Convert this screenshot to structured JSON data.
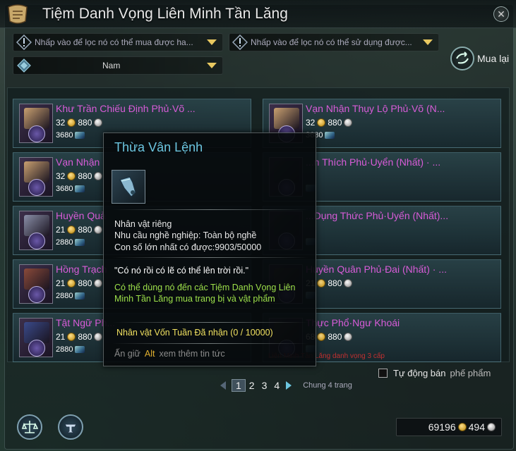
{
  "window": {
    "title": "Tiệm Danh Vọng Liên Minh Tần Lăng",
    "close_label": "✕"
  },
  "filters": {
    "buyable_placeholder": "Nhấp vào để lọc nó có thể mua được ha...",
    "usable_placeholder": "Nhấp vào để lọc nó có thể sử dụng được...",
    "gender_value": "Nam"
  },
  "buyback": {
    "label": "Mua lại"
  },
  "items": [
    {
      "name": "Khư Trần Chiếu Định Phủ·Võ ...",
      "price_gold": "32",
      "price_silver": "880",
      "price_alt": "3680",
      "color": "#c9a070"
    },
    {
      "name": "Vạn Nhận Thụy Lộ Phủ·Võ (N...",
      "price_gold": "32",
      "price_silver": "880",
      "price_alt": "3680",
      "color": "#c9a070"
    },
    {
      "name": "Vạn Nhận",
      "price_gold": "32",
      "price_silver": "880",
      "price_alt": "3680",
      "color": "#c9a070"
    },
    {
      "name": "...n Thích Phủ·Uyển (Nhất) · ...",
      "price_gold": "",
      "price_silver": "",
      "price_alt": "",
      "color": "#2e3a3a"
    },
    {
      "name": "Huyền Quả",
      "price_gold": "21",
      "price_silver": "880",
      "price_alt": "2880",
      "color": "#8a8fa8"
    },
    {
      "name": "...Dụng Thức Phủ·Uyển (Nhất)...",
      "price_gold": "",
      "price_silver": "",
      "price_alt": "",
      "color": "#2e3a3a"
    },
    {
      "name": "Hồng Trạch",
      "price_gold": "21",
      "price_silver": "880",
      "price_alt": "2880",
      "color": "#8a4a3a"
    },
    {
      "name": "Huyền Quân Phủ·Đai (Nhất) · ...",
      "price_gold": "21",
      "price_silver": "880",
      "price_alt": "",
      "color": "#4a4030"
    },
    {
      "name": "Tật Ngữ Ph...",
      "price_gold": "21",
      "price_silver": "880",
      "price_alt": "2880",
      "color": "#3a4a8a"
    },
    {
      "name": "Thực Phổ·Ngư Khoái",
      "price_gold": "68",
      "price_silver": "880",
      "price_alt": "",
      "color": "#4a4030"
    }
  ],
  "tooltip": {
    "title": "Thừa Vân Lệnh",
    "binding": "Nhân vật riêng",
    "requirement": "Nhu cầu nghề nghiệp: Toàn bộ nghề",
    "max_count": "Con số lớn nhất có được:9903/50000",
    "quote": "\"Có nó rồi có lẽ có thể lên trời rồi.\"",
    "usage": "Có thể dùng nó đến các Tiệm Danh Vọng Liên Minh Tần Lăng mua trang bị và vật phẩm",
    "progress": "Nhân vật Vốn Tuần Đã nhận (0 / 10000)",
    "hint_prefix": "Ấn giữ",
    "hint_key": "Alt",
    "hint_suffix": "xem thêm tin tức"
  },
  "red_note": "Liên Minh Tần Lăng danh vọng 3 cấp",
  "auto_sell": {
    "label": "Tự động bán",
    "muted": "phế phẩm"
  },
  "pager": {
    "pages": [
      "1",
      "2",
      "3",
      "4"
    ],
    "current": "1",
    "total": "Chung 4 trang"
  },
  "currency": {
    "amount_gold": "69196",
    "amount_silver": "494"
  },
  "colors": {
    "accent": "#6cc6e0",
    "item_name": "#d85cd8",
    "usage_text": "#9de04a",
    "progress_text": "#f0e060",
    "hint_key": "#e0b030",
    "warning": "#c03030"
  }
}
